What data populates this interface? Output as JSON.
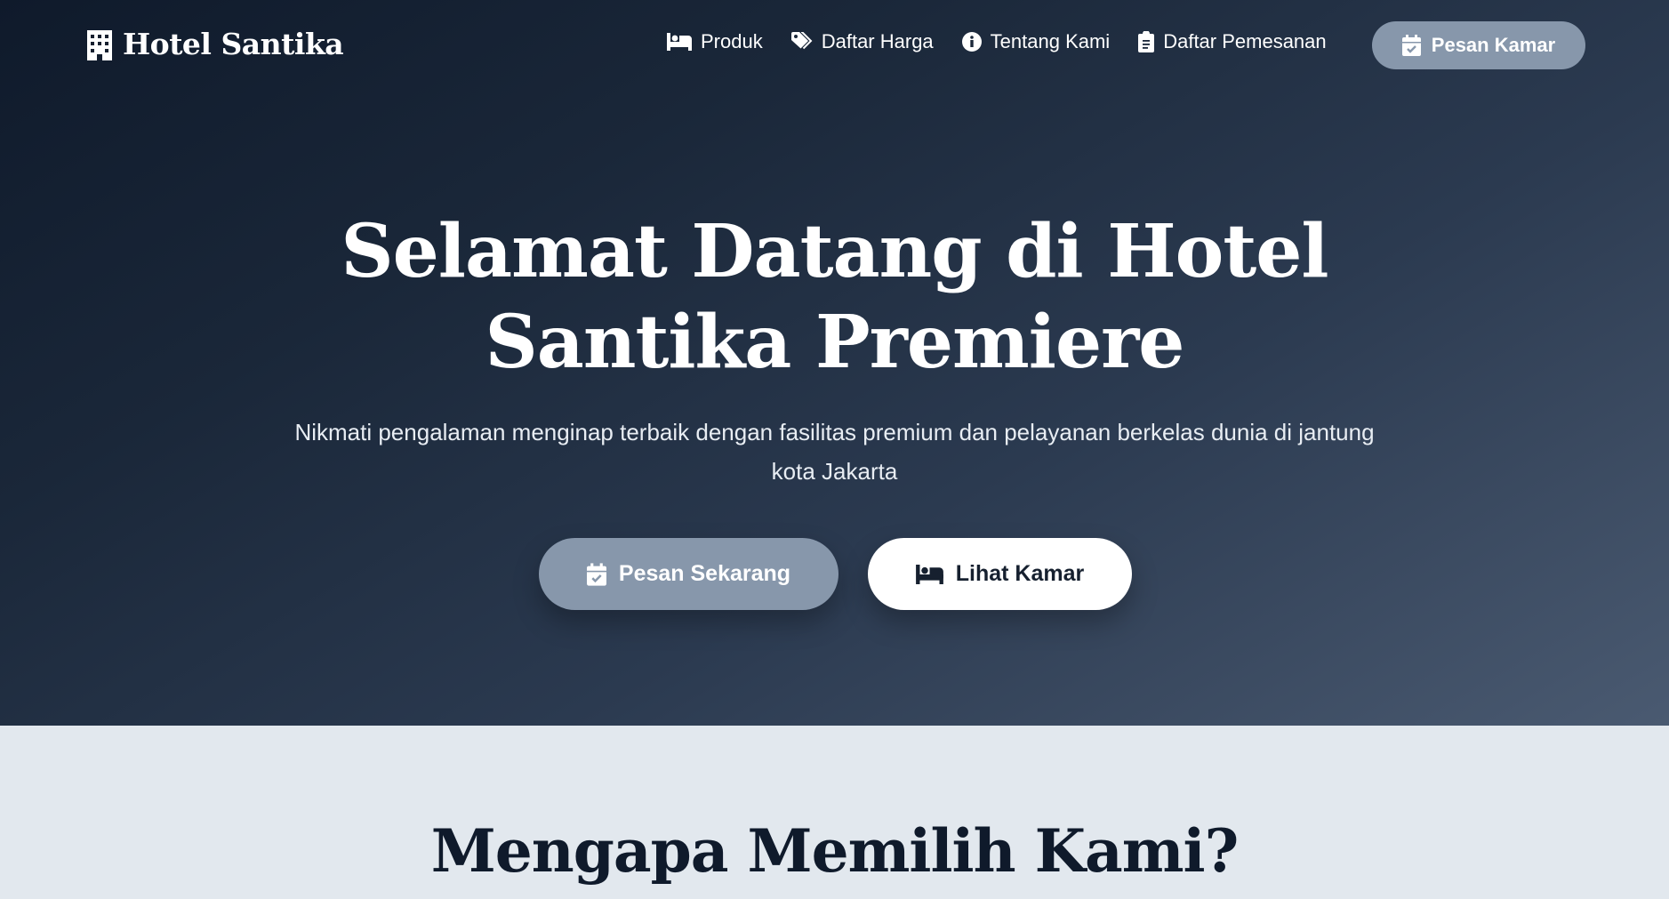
{
  "brand": {
    "name": "Hotel Santika",
    "icon": "hotel-building-icon"
  },
  "nav": {
    "items": [
      {
        "label": "Produk",
        "icon": "bed-icon"
      },
      {
        "label": "Daftar Harga",
        "icon": "tags-icon"
      },
      {
        "label": "Tentang Kami",
        "icon": "info-circle-icon"
      },
      {
        "label": "Daftar Pemesanan",
        "icon": "clipboard-icon"
      }
    ],
    "cta": {
      "label": "Pesan Kamar",
      "icon": "calendar-check-icon"
    }
  },
  "hero": {
    "title": "Selamat Datang di Hotel Santika Premiere",
    "subtitle": "Nikmati pengalaman menginap terbaik dengan fasilitas premium dan pelayanan berkelas dunia di jantung kota Jakarta",
    "primary_button": {
      "label": "Pesan Sekarang",
      "icon": "calendar-check-icon"
    },
    "secondary_button": {
      "label": "Lihat Kamar",
      "icon": "bed-icon"
    }
  },
  "features": {
    "title": "Mengapa Memilih Kami?"
  },
  "colors": {
    "hero_start": "#0f1a2b",
    "hero_end": "#4a5a71",
    "accent_button": "#8797ab",
    "section_bg": "#e2e8ee",
    "heading_dark": "#0f1a2b"
  }
}
